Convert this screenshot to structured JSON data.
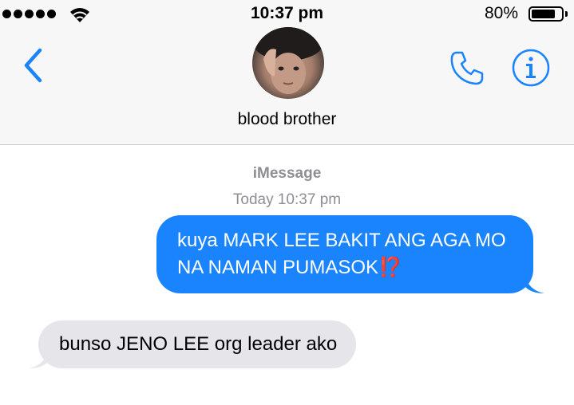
{
  "status_bar": {
    "time": "10:37 pm",
    "battery_percent": "80%",
    "battery_level": 0.8,
    "signal_bars": 5
  },
  "conversation": {
    "contact_name": "blood brother",
    "service_label": "iMessage",
    "timestamp": "Today 10:37 pm"
  },
  "messages": [
    {
      "direction": "sent",
      "text": "kuya MARK LEE BAKIT ANG AGA MO NA NAMAN PUMASOK",
      "emoji": "⁉️"
    },
    {
      "direction": "received",
      "text": "bunso JENO LEE org leader ako"
    }
  ],
  "icons": {
    "back": "chevron-left-icon",
    "call": "phone-icon",
    "info": "info-icon",
    "wifi": "wifi-icon",
    "battery": "battery-icon"
  },
  "colors": {
    "accent": "#1a84ff",
    "sent_bubble": "#1a84ff",
    "received_bubble": "#e5e5ea",
    "secondary_text": "#8e8e93",
    "header_bg": "#f7f7f7"
  }
}
